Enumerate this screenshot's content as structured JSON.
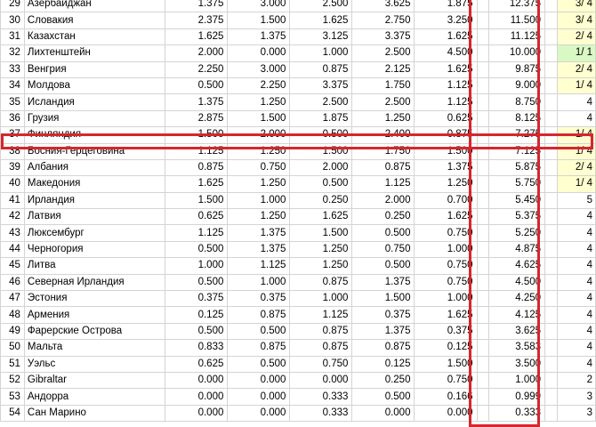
{
  "rows": [
    {
      "rank": "29",
      "name": "Азербайджан",
      "v1": "1.375",
      "v2": "3.000",
      "v3": "2.500",
      "v4": "3.625",
      "v5": "1.875",
      "total": "12.375",
      "count": "3/ 4",
      "color": "y"
    },
    {
      "rank": "30",
      "name": "Словакия",
      "v1": "2.375",
      "v2": "1.500",
      "v3": "1.625",
      "v4": "2.750",
      "v5": "3.250",
      "total": "11.500",
      "count": "3/ 4",
      "color": "y"
    },
    {
      "rank": "31",
      "name": "Казахстан",
      "v1": "1.625",
      "v2": "1.375",
      "v3": "3.125",
      "v4": "3.375",
      "v5": "1.625",
      "total": "11.125",
      "count": "2/ 4",
      "color": "y"
    },
    {
      "rank": "32",
      "name": "Лихтенштейн",
      "v1": "2.000",
      "v2": "0.000",
      "v3": "1.000",
      "v4": "2.500",
      "v5": "4.500",
      "total": "10.000",
      "count": "1/ 1",
      "color": "g"
    },
    {
      "rank": "33",
      "name": "Венгрия",
      "v1": "2.250",
      "v2": "3.000",
      "v3": "0.875",
      "v4": "2.125",
      "v5": "1.625",
      "total": "9.875",
      "count": "2/ 4",
      "color": "y"
    },
    {
      "rank": "34",
      "name": "Молдова",
      "v1": "0.500",
      "v2": "2.250",
      "v3": "3.375",
      "v4": "1.750",
      "v5": "1.125",
      "total": "9.000",
      "count": "1/ 4",
      "color": "y"
    },
    {
      "rank": "35",
      "name": "Исландия",
      "v1": "1.375",
      "v2": "1.250",
      "v3": "2.500",
      "v4": "2.500",
      "v5": "1.125",
      "total": "8.750",
      "count": "4",
      "color": ""
    },
    {
      "rank": "36",
      "name": "Грузия",
      "v1": "2.875",
      "v2": "1.500",
      "v3": "1.875",
      "v4": "1.250",
      "v5": "0.625",
      "total": "8.125",
      "count": "4",
      "color": ""
    },
    {
      "rank": "37",
      "name": "Финляндия",
      "v1": "1.500",
      "v2": "2.000",
      "v3": "0.500",
      "v4": "2.400",
      "v5": "0.875",
      "total": "7.275",
      "count": "1/ 4",
      "color": "y"
    },
    {
      "rank": "38",
      "name": "Босния-Герцеговина",
      "v1": "1.125",
      "v2": "1.250",
      "v3": "1.500",
      "v4": "1.750",
      "v5": "1.500",
      "total": "7.125",
      "count": "1/ 4",
      "color": "y"
    },
    {
      "rank": "39",
      "name": "Албания",
      "v1": "0.875",
      "v2": "0.750",
      "v3": "2.000",
      "v4": "0.875",
      "v5": "1.375",
      "total": "5.875",
      "count": "2/ 4",
      "color": "y"
    },
    {
      "rank": "40",
      "name": "Македония",
      "v1": "1.625",
      "v2": "1.250",
      "v3": "0.500",
      "v4": "1.125",
      "v5": "1.250",
      "total": "5.750",
      "count": "1/ 4",
      "color": "y"
    },
    {
      "rank": "41",
      "name": "Ирландия",
      "v1": "1.500",
      "v2": "1.000",
      "v3": "0.250",
      "v4": "2.000",
      "v5": "0.700",
      "total": "5.450",
      "count": "5",
      "color": ""
    },
    {
      "rank": "42",
      "name": "Латвия",
      "v1": "0.625",
      "v2": "1.250",
      "v3": "1.625",
      "v4": "0.250",
      "v5": "1.625",
      "total": "5.375",
      "count": "4",
      "color": ""
    },
    {
      "rank": "43",
      "name": "Люксембург",
      "v1": "1.125",
      "v2": "1.375",
      "v3": "1.500",
      "v4": "0.500",
      "v5": "0.750",
      "total": "5.250",
      "count": "4",
      "color": ""
    },
    {
      "rank": "44",
      "name": "Черногория",
      "v1": "0.500",
      "v2": "1.375",
      "v3": "1.250",
      "v4": "0.750",
      "v5": "1.000",
      "total": "4.875",
      "count": "4",
      "color": ""
    },
    {
      "rank": "45",
      "name": "Литва",
      "v1": "1.000",
      "v2": "1.125",
      "v3": "1.250",
      "v4": "0.500",
      "v5": "0.750",
      "total": "4.625",
      "count": "4",
      "color": ""
    },
    {
      "rank": "46",
      "name": "Северная Ирландия",
      "v1": "0.500",
      "v2": "1.000",
      "v3": "0.875",
      "v4": "1.375",
      "v5": "0.750",
      "total": "4.500",
      "count": "4",
      "color": ""
    },
    {
      "rank": "47",
      "name": "Эстония",
      "v1": "0.375",
      "v2": "0.375",
      "v3": "1.000",
      "v4": "1.500",
      "v5": "1.000",
      "total": "4.250",
      "count": "4",
      "color": ""
    },
    {
      "rank": "48",
      "name": "Армения",
      "v1": "0.125",
      "v2": "0.875",
      "v3": "1.125",
      "v4": "0.375",
      "v5": "1.625",
      "total": "4.125",
      "count": "4",
      "color": ""
    },
    {
      "rank": "49",
      "name": "Фарерские Острова",
      "v1": "0.500",
      "v2": "0.500",
      "v3": "0.875",
      "v4": "1.375",
      "v5": "0.375",
      "total": "3.625",
      "count": "4",
      "color": ""
    },
    {
      "rank": "50",
      "name": "Мальта",
      "v1": "0.833",
      "v2": "0.875",
      "v3": "0.875",
      "v4": "0.875",
      "v5": "0.125",
      "total": "3.583",
      "count": "4",
      "color": ""
    },
    {
      "rank": "51",
      "name": "Уэльс",
      "v1": "0.625",
      "v2": "0.500",
      "v3": "0.750",
      "v4": "0.125",
      "v5": "1.500",
      "total": "3.500",
      "count": "4",
      "color": ""
    },
    {
      "rank": "52",
      "name": "Gibraltar",
      "v1": "0.000",
      "v2": "0.000",
      "v3": "0.000",
      "v4": "0.250",
      "v5": "0.750",
      "total": "1.000",
      "count": "2",
      "color": ""
    },
    {
      "rank": "53",
      "name": "Андорра",
      "v1": "0.000",
      "v2": "0.000",
      "v3": "0.333",
      "v4": "0.500",
      "v5": "0.166",
      "total": "0.999",
      "count": "3",
      "color": ""
    },
    {
      "rank": "54",
      "name": "Сан Марино",
      "v1": "0.000",
      "v2": "0.000",
      "v3": "0.333",
      "v4": "0.000",
      "v5": "0.000",
      "total": "0.333",
      "count": "3",
      "color": ""
    }
  ]
}
